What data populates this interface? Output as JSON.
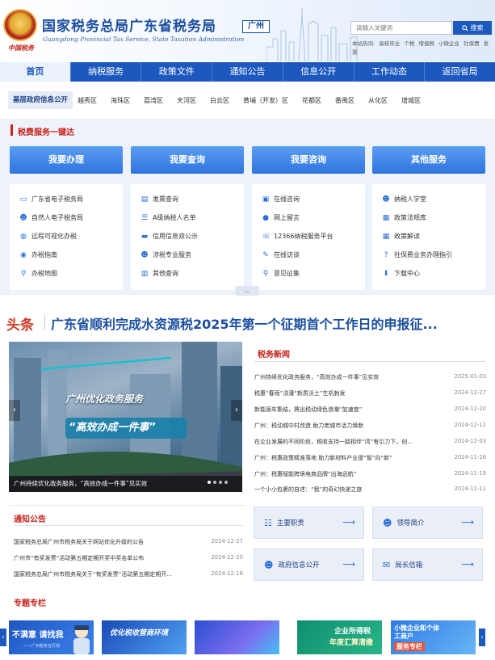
{
  "header": {
    "title": "国家税务总局广东省税务局",
    "city_badge": "广州",
    "subtitle": "Guangdong Provincial Tax Service, State Taxation Administration",
    "logo_text": "中国税务",
    "search_placeholder": "请输入关键词",
    "search_button": "搜索",
    "hot_label": "本站热词:",
    "hot_words": [
      "高校毕业",
      "个税",
      "增值税",
      "小微企业",
      "社保费",
      "发票"
    ]
  },
  "nav": {
    "items": [
      "首页",
      "纳税服务",
      "政策文件",
      "通知公告",
      "信息公开",
      "工作动态",
      "返回省局"
    ],
    "active_index": 0
  },
  "subnav": {
    "title": "基层政府信息公开",
    "districts": [
      "越秀区",
      "海珠区",
      "荔湾区",
      "天河区",
      "白云区",
      "黄埔（开发）区",
      "花都区",
      "番禺区",
      "从化区",
      "增城区"
    ]
  },
  "services": {
    "title": "税费服务一键达",
    "columns": [
      {
        "button": "我要办理",
        "links": [
          {
            "label": "广东省电子税务局",
            "icon": "monitor-icon"
          },
          {
            "label": "自然人电子税务局",
            "icon": "person-icon"
          },
          {
            "label": "远程可视化办税",
            "icon": "globe-icon"
          },
          {
            "label": "办税指南",
            "icon": "compass-icon"
          },
          {
            "label": "办税地图",
            "icon": "map-pin-icon"
          }
        ]
      },
      {
        "button": "我要查询",
        "links": [
          {
            "label": "发票查询",
            "icon": "invoice-icon"
          },
          {
            "label": "A级纳税人名单",
            "icon": "list-icon"
          },
          {
            "label": "信用信息双公示",
            "icon": "credit-card-icon"
          },
          {
            "label": "涉税专业服务",
            "icon": "person-icon"
          },
          {
            "label": "其他查询",
            "icon": "search-doc-icon"
          }
        ]
      },
      {
        "button": "我要咨询",
        "links": [
          {
            "label": "在线咨询",
            "icon": "laptop-icon"
          },
          {
            "label": "网上留言",
            "icon": "chat-icon"
          },
          {
            "label": "12366纳税服务平台",
            "icon": "phone-icon"
          },
          {
            "label": "在线访谈",
            "icon": "pen-icon"
          },
          {
            "label": "意见征集",
            "icon": "map-pin-icon"
          }
        ]
      },
      {
        "button": "其他服务",
        "links": [
          {
            "label": "纳税人学堂",
            "icon": "people-icon"
          },
          {
            "label": "政策法规库",
            "icon": "book-icon"
          },
          {
            "label": "政策解读",
            "icon": "book-icon"
          },
          {
            "label": "社保费业务办理指引",
            "icon": "help-icon"
          },
          {
            "label": "下载中心",
            "icon": "download-icon"
          }
        ]
      }
    ]
  },
  "headline": {
    "tag": "头条",
    "text": "广东省顺利完成水资源税2025年第一个征期首个工作日的申报征..."
  },
  "carousel": {
    "banner_line1": "广州优化政务服务",
    "banner_line2": "“高效办成一件事”",
    "caption": "广州持续优化政务服务，“高效办成一件事”见实效"
  },
  "news": {
    "title": "税务新闻",
    "items": [
      {
        "title": "广州持续优化政务服务，“高效办成一件事”见实效",
        "date": "2025-01-03"
      },
      {
        "title": "税惠“春雨”浇灌“新质沃土”生机勃发",
        "date": "2024-12-27"
      },
      {
        "title": "新能源车集结，赛出税动绿色浪潮“加速度”",
        "date": "2024-12-20"
      },
      {
        "title": "广州：税动城中村改造 助力老城市活力焕新",
        "date": "2024-12-12"
      },
      {
        "title": "在企业发展的不同阶段，税收支持一路相伴“湾”有引力下，创...",
        "date": "2024-12-03"
      },
      {
        "title": "广州：税惠政策精准落地 助力新材料产业提“智”向“新”",
        "date": "2024-11-26"
      },
      {
        "title": "广州：税惠赋能跨境电商品牌“出海远航”",
        "date": "2024-11-19"
      },
      {
        "title": "一个小小包裹的自述：“我”的奇幻快递之旅",
        "date": "2024-11-11"
      }
    ]
  },
  "notices": {
    "title": "通知公告",
    "items": [
      {
        "title": "国家税务总局广州市税务局关于网站优化升级的公告",
        "date": "2024-12-27"
      },
      {
        "title": "广州市“有奖发票”活动第五期定期开奖中奖名单公布",
        "date": "2024-12-20"
      },
      {
        "title": "国家税务总局广州市税务局关于“有奖发票”活动第五期定期开...",
        "date": "2024-12-16"
      }
    ]
  },
  "quick_links": [
    {
      "label": "主要职责",
      "icon": "org-chart-icon"
    },
    {
      "label": "领导简介",
      "icon": "person-icon"
    },
    {
      "label": "政府信息公开",
      "icon": "people-icon"
    },
    {
      "label": "局长信箱",
      "icon": "mail-icon"
    }
  ],
  "topics": {
    "title": "专题专栏",
    "banners": [
      {
        "text": "不满意 请找我",
        "sub": "——广州税务在行动"
      },
      {
        "text": "优化税收营商环境",
        "sub": ""
      },
      {
        "text": "",
        "sub": ""
      },
      {
        "text": "企业所得税",
        "sub": "年度汇算清缴"
      },
      {
        "text": "小微企业和个体工商户",
        "sub": "服务专栏"
      }
    ]
  },
  "colors": {
    "brand_blue": "#1d58bf",
    "accent_red": "#c7221b",
    "headline_blue": "#1b4ea1"
  }
}
